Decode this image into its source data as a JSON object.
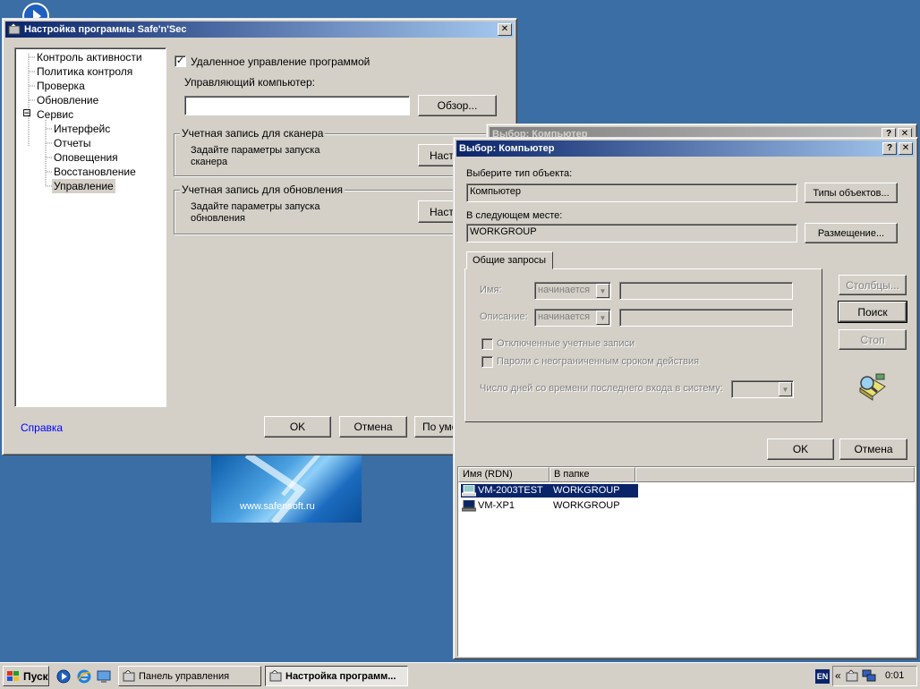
{
  "settings_window": {
    "title": "Настройка программы Safe'n'Sec",
    "tree": [
      {
        "label": "Контроль активности"
      },
      {
        "label": "Политика контроля"
      },
      {
        "label": "Проверка"
      },
      {
        "label": "Обновление"
      },
      {
        "label": "Сервис"
      },
      {
        "label": "Интерфейс"
      },
      {
        "label": "Отчеты"
      },
      {
        "label": "Оповещения"
      },
      {
        "label": "Восстановление"
      },
      {
        "label": "Управление"
      }
    ],
    "tree_expander": "⊟",
    "remote_checkbox_label": "Удаленное управление программой",
    "remote_checked": true,
    "managing_computer_label": "Управляющий компьютер:",
    "managing_computer_value": "",
    "browse_button": "Обзор...",
    "scanner_group_label": "Учетная запись для сканера",
    "scanner_text": "Задайте параметры запуска сканера",
    "scanner_button": "Настройка...",
    "update_group_label": "Учетная запись для обновления",
    "update_text": "Задайте параметры запуска обновления",
    "update_button": "Настройка...",
    "help_link": "Справка",
    "ok_button": "OK",
    "cancel_button": "Отмена",
    "default_button": "По умолчанию"
  },
  "behind_dialog": {
    "title": "Выбор: Компьютер"
  },
  "select_dialog": {
    "title": "Выбор: Компьютер",
    "help_btn": "?",
    "close_btn": "✕",
    "object_type_label": "Выберите тип объекта:",
    "object_type_value": "Компьютер",
    "object_types_button": "Типы объектов...",
    "location_label": "В следующем месте:",
    "location_value": "WORKGROUP",
    "location_button": "Размещение...",
    "tab_label": "Общие запросы",
    "name_label": "Имя:",
    "name_mode": "начинается",
    "description_label": "Описание:",
    "description_mode": "начинается",
    "disabled_accounts_label": "Отключенные учетные записи",
    "nonexpiring_pw_label": "Пароли с неограниченным сроком действия",
    "days_label": "Число дней со времени последнего входа в систему:",
    "columns_button": "Столбцы...",
    "search_button": "Поиск",
    "stop_button": "Стоп",
    "ok_button": "OK",
    "cancel_button": "Отмена",
    "results_columns": [
      "Имя (RDN)",
      "В папке"
    ],
    "results": [
      {
        "name": "VM-2003TEST",
        "folder": "WORKGROUP",
        "selected": true
      },
      {
        "name": "VM-XP1",
        "folder": "WORKGROUP",
        "selected": false
      }
    ]
  },
  "banner": {
    "url": "www.safensoft.ru"
  },
  "taskbar": {
    "start_label": "Пуск",
    "tasks": [
      {
        "label": "Панель управления",
        "active": false
      },
      {
        "label": "Настройка программ...",
        "active": true
      }
    ],
    "lang": "EN",
    "clock": "0:01",
    "tray_chevron": "«"
  },
  "colors": {
    "desktop": "#3a6ea5",
    "title_active": "#0a246a",
    "selection": "#0a246a",
    "link": "#0000ff"
  }
}
